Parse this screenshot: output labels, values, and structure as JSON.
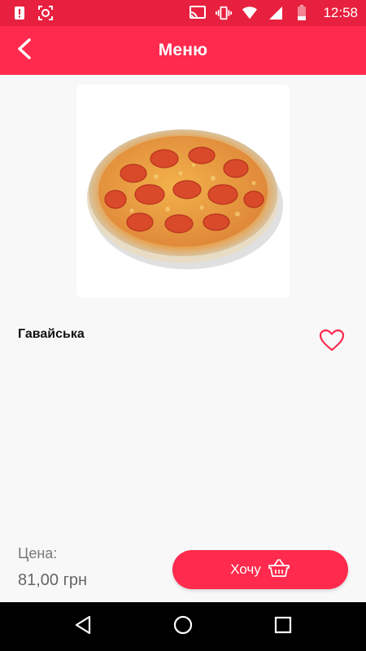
{
  "status_bar": {
    "time": "12:58",
    "icons": [
      "alert-icon",
      "screenshot-icon",
      "cast-icon",
      "vibrate-icon",
      "wifi-icon",
      "signal-icon",
      "battery-icon"
    ]
  },
  "app_bar": {
    "title": "Меню",
    "back_icon": "back-arrow-icon"
  },
  "product": {
    "image": "pizza-image",
    "name": "Гавайська",
    "favorite_icon": "heart-outline-icon"
  },
  "price": {
    "label": "Цена:",
    "value": "81,00 грн"
  },
  "want_button": {
    "label": "Хочу",
    "icon": "basket-icon"
  },
  "nav_bar": {
    "icons": [
      "nav-back-icon",
      "nav-home-icon",
      "nav-recents-icon"
    ]
  },
  "colors": {
    "primary": "#ff2a4d",
    "status_bar": "#e8203f",
    "background": "#f8f8f8"
  }
}
